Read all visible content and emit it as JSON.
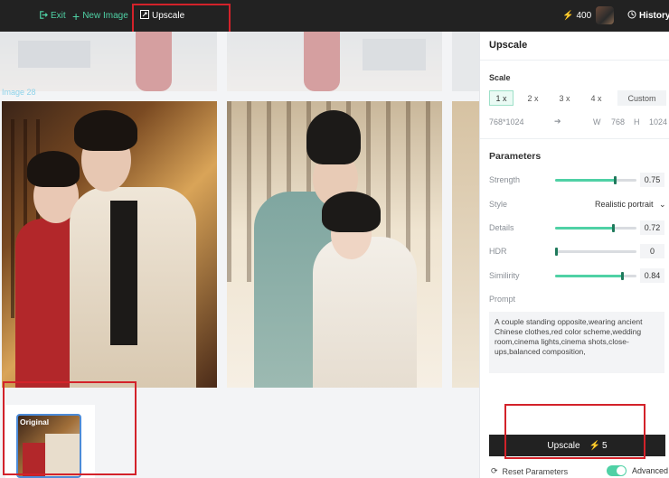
{
  "topbar": {
    "exit_label": "Exit",
    "new_image_label": "New Image",
    "upscale_label": "Upscale",
    "credits": "400",
    "history_label": "History"
  },
  "canvas": {
    "image_caption": "Image 28",
    "original_badge": "Original"
  },
  "panel": {
    "title": "Upscale",
    "scale_label": "Scale",
    "scale_options": [
      "1 x",
      "2 x",
      "3 x",
      "4 x",
      "Custom"
    ],
    "selected_scale": "1 x",
    "resolution": "768*1024",
    "width_label": "W",
    "width_value": "768",
    "height_label": "H",
    "height_value": "1024",
    "parameters_label": "Parameters",
    "strength_label": "Strength",
    "strength_value": "0.75",
    "style_label": "Style",
    "style_value": "Realistic portrait",
    "details_label": "Details",
    "details_value": "0.72",
    "hdr_label": "HDR",
    "hdr_value": "0",
    "similarity_label": "Similirity",
    "similarity_value": "0.84",
    "prompt_label": "Prompt",
    "prompt_text": "A couple standing opposite,wearing ancient Chinese clothes,red color scheme,wedding room,cinema lights,cinema shots,close-ups,balanced composition,",
    "upscale_button": "Upscale",
    "upscale_cost": "5",
    "reset_label": "Reset Parameters",
    "advanced_label": "Advanced"
  },
  "colors": {
    "accent": "#4fd1a5",
    "highlight": "#d3222a",
    "topbar_bg": "#222222"
  }
}
